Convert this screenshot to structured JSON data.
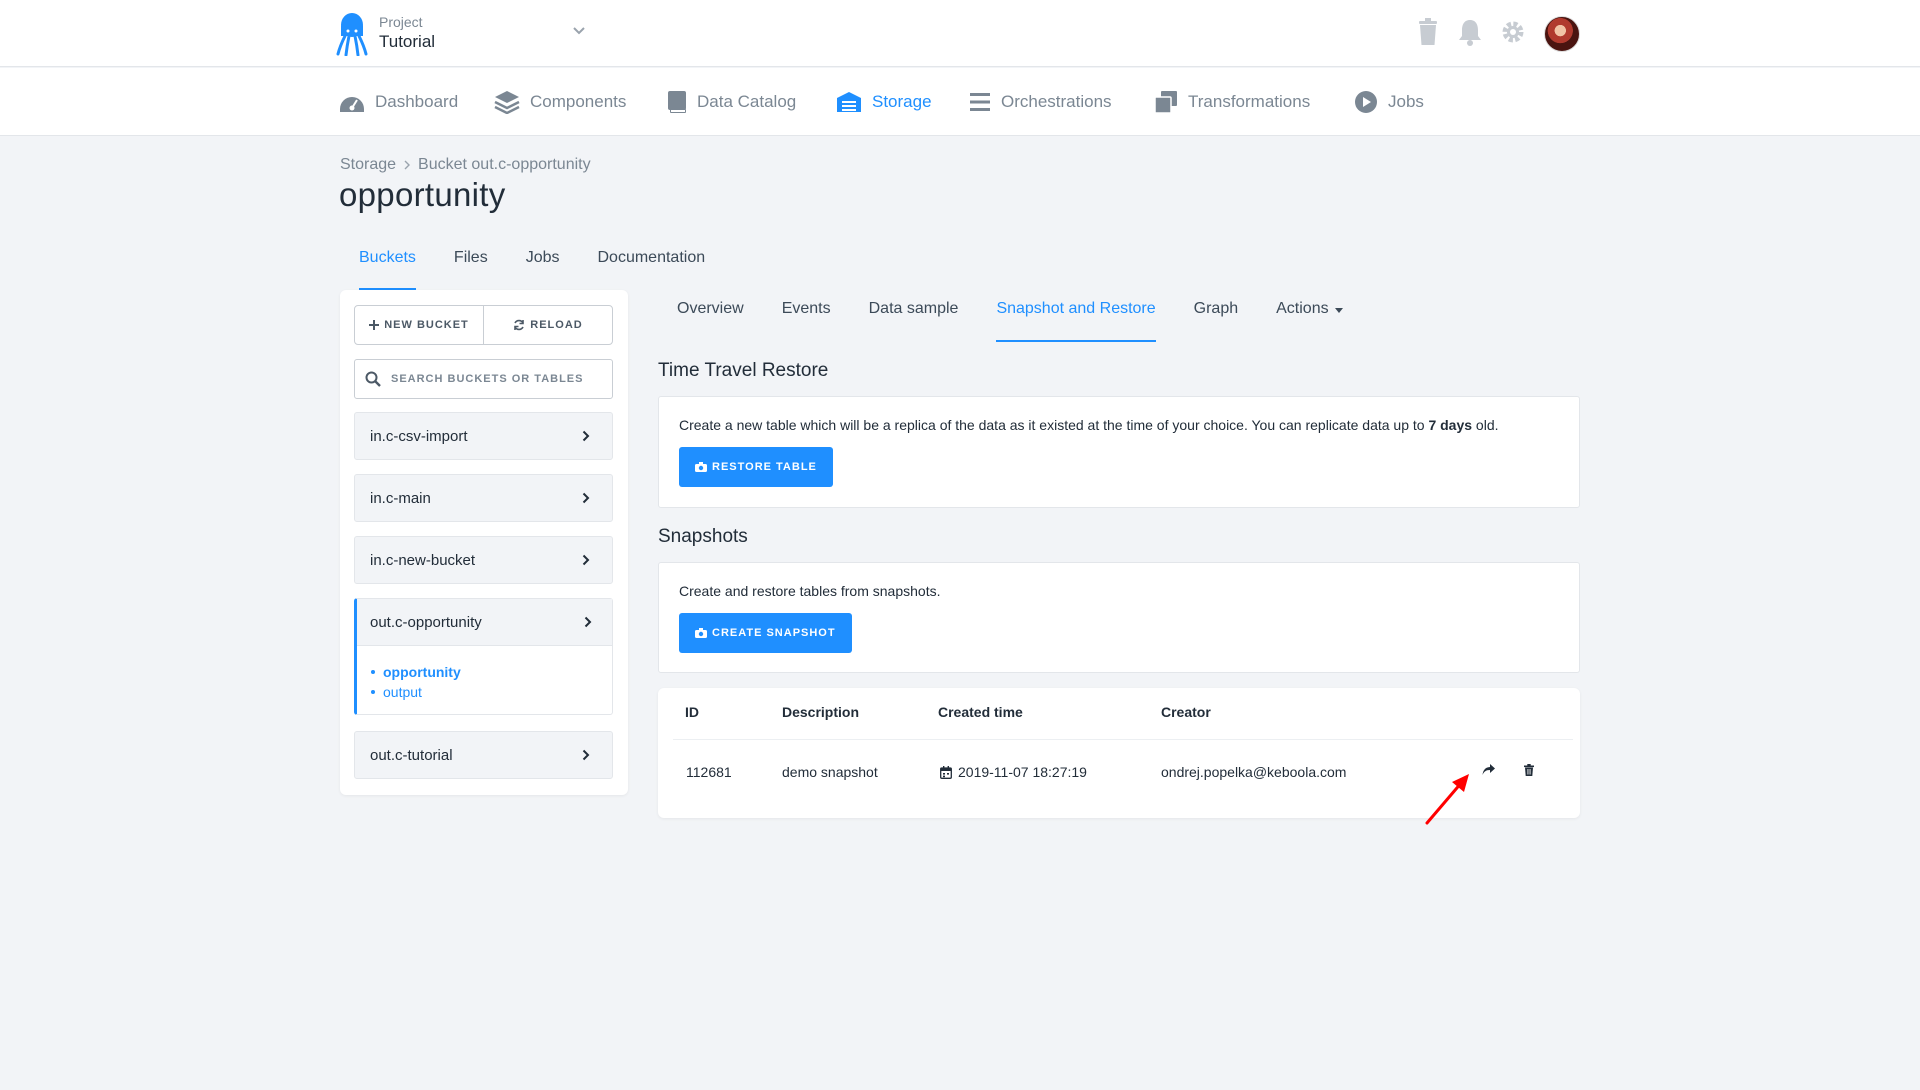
{
  "header": {
    "project_label": "Project",
    "project_name": "Tutorial"
  },
  "nav": {
    "items": [
      {
        "label": "Dashboard",
        "icon": "dashboard-gauge-icon",
        "active": false
      },
      {
        "label": "Components",
        "icon": "layers-icon",
        "active": false
      },
      {
        "label": "Data Catalog",
        "icon": "book-icon",
        "active": false
      },
      {
        "label": "Storage",
        "icon": "warehouse-icon",
        "active": true
      },
      {
        "label": "Orchestrations",
        "icon": "bars-icon",
        "active": false
      },
      {
        "label": "Transformations",
        "icon": "windows-icon",
        "active": false
      },
      {
        "label": "Jobs",
        "icon": "play-circle-icon",
        "active": false
      }
    ]
  },
  "breadcrumb": {
    "root": "Storage",
    "current": "Bucket out.c-opportunity"
  },
  "page_title": "opportunity",
  "tabs": [
    "Buckets",
    "Files",
    "Jobs",
    "Documentation"
  ],
  "sidebar": {
    "new_bucket_label": "NEW BUCKET",
    "reload_label": "RELOAD",
    "search_placeholder": "SEARCH BUCKETS OR TABLES",
    "buckets": [
      "in.c-csv-import",
      "in.c-main",
      "in.c-new-bucket",
      "out.c-opportunity",
      "out.c-tutorial"
    ],
    "open_bucket_tables": [
      "opportunity",
      "output"
    ]
  },
  "subtabs": [
    "Overview",
    "Events",
    "Data sample",
    "Snapshot and Restore",
    "Graph",
    "Actions"
  ],
  "time_travel": {
    "title": "Time Travel Restore",
    "text_before": "Create a new table which will be a replica of the data as it existed at the time of your choice. You can replicate data up to ",
    "text_bold": "7 days",
    "text_after": " old.",
    "button_label": "RESTORE TABLE"
  },
  "snapshots": {
    "title": "Snapshots",
    "text": "Create and restore tables from snapshots.",
    "button_label": "CREATE SNAPSHOT",
    "columns": [
      "ID",
      "Description",
      "Created time",
      "Creator"
    ],
    "rows": [
      {
        "id": "112681",
        "description": "demo snapshot",
        "created": "2019-11-07 18:27:19",
        "creator": "ondrej.popelka@keboola.com"
      }
    ]
  },
  "colors": {
    "accent": "#1f8fff",
    "annotation_arrow": "#ff0000"
  }
}
